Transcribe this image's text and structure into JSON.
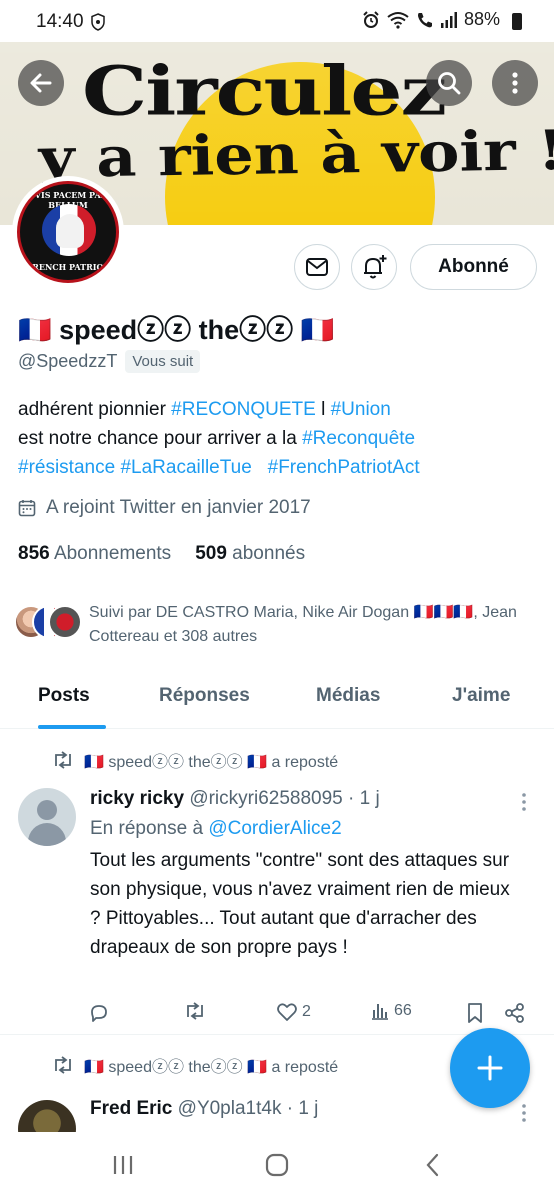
{
  "status_bar": {
    "time": "14:40",
    "battery": "88%",
    "icons": [
      "shield-icon",
      "alarm-icon",
      "wifi-icon",
      "call-icon",
      "signal-icon",
      "battery-icon"
    ]
  },
  "banner": {
    "line1": "Circulez",
    "line2": "y a rien à voir !",
    "colors": {
      "sun": "#f6cd12",
      "text": "#111111"
    }
  },
  "avatar": {
    "top_text": "SI VIS PACEM PARA BELLUM",
    "bottom_text": "FRENCH PATRIOT"
  },
  "profile": {
    "name": "🇫🇷 speedⓩⓩ theⓩⓩ 🇫🇷",
    "handle": "@SpeedzzT",
    "follows_you": "Vous suit",
    "follow_button": "Abonné",
    "bio": {
      "line1_plain": "adhérent pionnier ",
      "tag1": "#RECONQUETE",
      "line1_mid": " l ",
      "tag2": "#Union",
      "line2_plain": "est notre chance pour arriver a la ",
      "tag3": "#Reconquête",
      "tag4": "#résistance",
      "tag5": "#LaRacailleTue",
      "tag6": "#FrenchPatriotAct"
    },
    "joined": "A rejoint Twitter en janvier 2017",
    "following_count": "856",
    "following_label": "Abonnements",
    "followers_count": "509",
    "followers_label": "abonnés",
    "followed_by": "Suivi par DE CASTRO Maria, Nike Air Dogan 🇫🇷🇫🇷🇫🇷, Jean Cottereau et 308 autres"
  },
  "tabs": [
    {
      "label": "Posts",
      "active": true
    },
    {
      "label": "Réponses",
      "active": false
    },
    {
      "label": "Médias",
      "active": false
    },
    {
      "label": "J'aime",
      "active": false
    }
  ],
  "tweets": [
    {
      "repost_label": "🇫🇷 speedⓩⓩ theⓩⓩ 🇫🇷 a reposté",
      "name": "ricky ricky",
      "meta": "@rickyri62588095 · 1 j",
      "reply_prefix": "En réponse à ",
      "reply_to": "@CordierAlice2",
      "text": "Tout les arguments \"contre\" sont des attaques sur son physique, vous n'avez vraiment rien de mieux ? Pittoyables... Tout autant que d'arracher des drapeaux de son propre pays !",
      "likes": "2",
      "views": "66"
    },
    {
      "repost_label": "🇫🇷 speedⓩⓩ theⓩⓩ 🇫🇷 a reposté",
      "name": "Fred Eric",
      "meta": "@Y0pla1t4k · 1 j"
    }
  ],
  "colors": {
    "accent": "#1d9bf0",
    "muted": "#536471",
    "text": "#0f1419",
    "border": "#cfd9de"
  }
}
